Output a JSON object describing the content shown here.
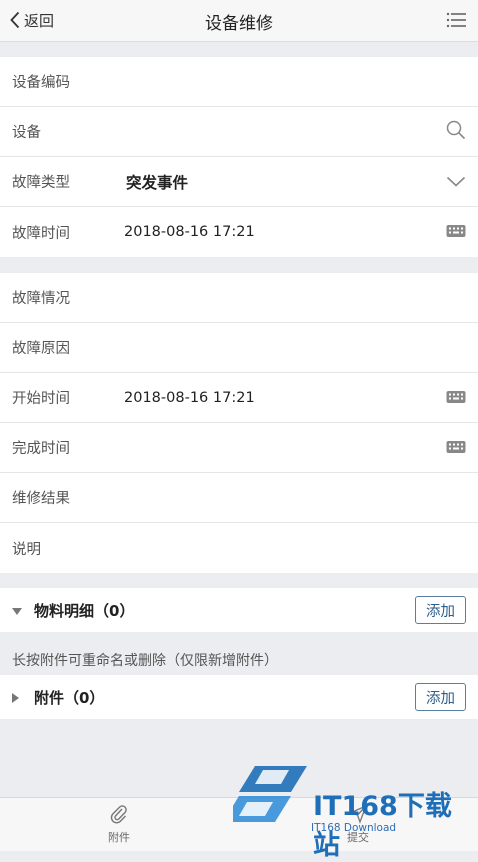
{
  "header": {
    "back_label": "返回",
    "title": "设备维修"
  },
  "form1": {
    "device_code_label": "设备编码",
    "device_label": "设备",
    "fault_type_label": "故障类型",
    "fault_type_value": "突发事件",
    "fault_time_label": "故障时间",
    "fault_time_value": "2018-08-16 17:21"
  },
  "form2": {
    "fault_desc_label": "故障情况",
    "fault_cause_label": "故障原因",
    "start_time_label": "开始时间",
    "start_time_value": "2018-08-16 17:21",
    "finish_time_label": "完成时间",
    "result_label": "维修结果",
    "note_label": "说明"
  },
  "materials": {
    "label": "物料明细（0）",
    "add_label": "添加"
  },
  "hint": "长按附件可重命名或删除（仅限新增附件）",
  "attachments": {
    "label": "附件（0）",
    "add_label": "添加"
  },
  "footer": {
    "attachment_label": "附件",
    "submit_label": "提交"
  },
  "watermark": {
    "brand": "IT168下载站",
    "sub": "IT168 Download"
  },
  "colors": {
    "accent": "#2d5f8a",
    "background": "#ecedf0",
    "watermark": "#1e6fb8"
  }
}
